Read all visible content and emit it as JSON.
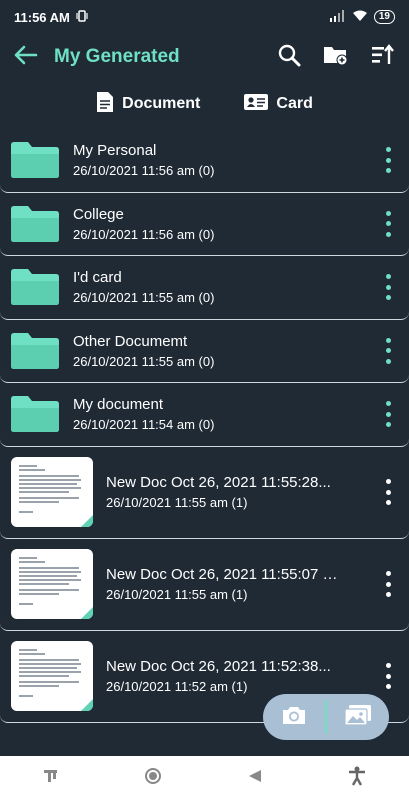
{
  "status": {
    "time": "11:56 AM",
    "battery": "19"
  },
  "app_bar": {
    "title": "My Generated"
  },
  "tabs": [
    {
      "label": "Document"
    },
    {
      "label": "Card"
    }
  ],
  "folders": [
    {
      "name": "My Personal",
      "meta": "26/10/2021 11:56 am (0)"
    },
    {
      "name": "College",
      "meta": "26/10/2021 11:56 am (0)"
    },
    {
      "name": "I'd card",
      "meta": "26/10/2021 11:55 am (0)"
    },
    {
      "name": "Other Documemt",
      "meta": "26/10/2021 11:55 am (0)"
    },
    {
      "name": "My document",
      "meta": "26/10/2021 11:54 am (0)"
    }
  ],
  "documents": [
    {
      "name": "New Doc Oct 26, 2021 11:55:28...",
      "meta": "26/10/2021 11:55 am (1)"
    },
    {
      "name": "New Doc Oct 26, 2021 11:55:07 a...",
      "meta": "26/10/2021 11:55 am (1)"
    },
    {
      "name": "New Doc Oct 26, 2021 11:52:38...",
      "meta": "26/10/2021 11:52 am (1)"
    }
  ],
  "colors": {
    "accent": "#6fe0c3",
    "background": "#1f2a35",
    "fab": "#a9bfd4"
  },
  "icons": {
    "back": "arrow-left-icon",
    "search": "search-icon",
    "new_folder": "folder-add-icon",
    "sort": "sort-icon",
    "camera": "camera-icon",
    "gallery": "gallery-icon"
  }
}
